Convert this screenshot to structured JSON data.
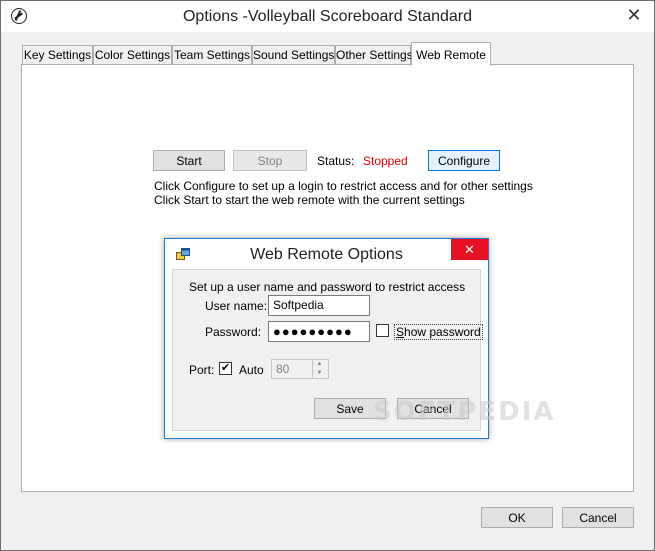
{
  "window": {
    "title": "Options -Volleyball Scoreboard Standard",
    "close_glyph": "✕"
  },
  "tabs": [
    {
      "label": "Key Settings"
    },
    {
      "label": "Color Settings"
    },
    {
      "label": "Team Settings"
    },
    {
      "label": "Sound Settings"
    },
    {
      "label": "Other Settings"
    },
    {
      "label": "Web Remote",
      "active": true
    }
  ],
  "web_remote": {
    "start_label": "Start",
    "stop_label": "Stop",
    "status_label": "Status:",
    "status_value": "Stopped",
    "status_color": "#e00000",
    "configure_label": "Configure",
    "hint_line1": "Click Configure to set up a login to restrict access and for other settings",
    "hint_line2": "Click Start to start the web remote with the current settings"
  },
  "dialog": {
    "title": "Web Remote Options",
    "close_glyph": "✕",
    "close_color": "#e81123",
    "instructions": "Set up a user name and password to restrict access",
    "username_label": "User name:",
    "username_value": "Softpedia",
    "password_label": "Password:",
    "password_value": "●●●●●●●●●",
    "show_password_label": "Show password",
    "show_password_checked": false,
    "port_label": "Port:",
    "auto_label": "Auto",
    "auto_checked": true,
    "port_value": "80",
    "save_label": "Save",
    "cancel_label": "Cancel"
  },
  "footer": {
    "ok_label": "OK",
    "cancel_label": "Cancel"
  },
  "watermark": "SOFTPEDIA"
}
